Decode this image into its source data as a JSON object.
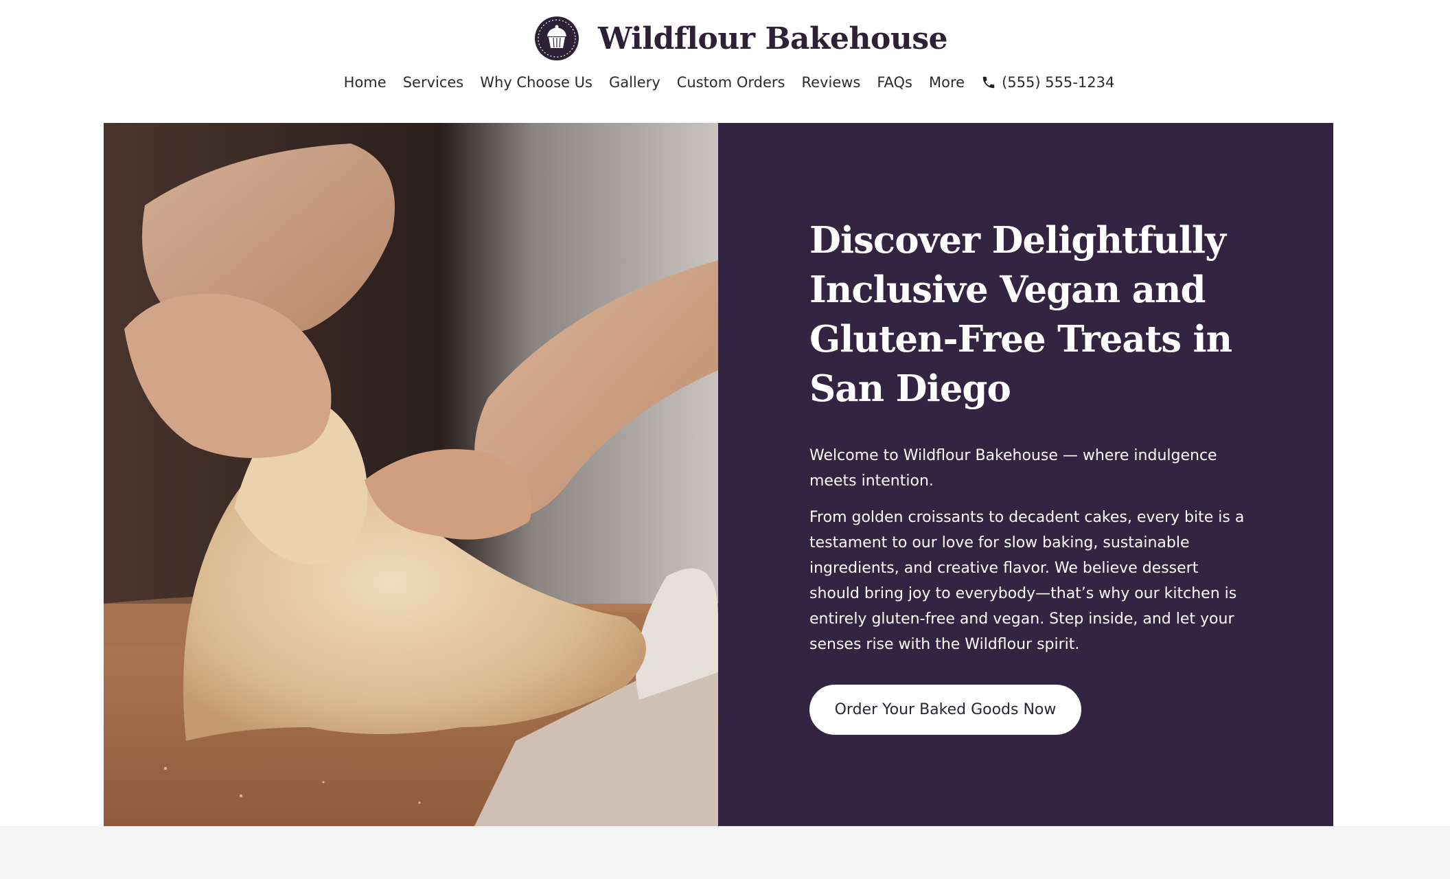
{
  "site": {
    "name": "Wildflour Bakehouse",
    "logo_icon": "cupcake-badge-icon"
  },
  "nav": {
    "items": [
      {
        "label": "Home"
      },
      {
        "label": "Services"
      },
      {
        "label": "Why Choose Us"
      },
      {
        "label": "Gallery"
      },
      {
        "label": "Custom Orders"
      },
      {
        "label": "Reviews"
      },
      {
        "label": "FAQs"
      },
      {
        "label": "More"
      }
    ],
    "phone": {
      "icon": "phone-icon",
      "label": "(555) 555-1234"
    }
  },
  "hero": {
    "image": "dough-kneading-photo",
    "title": "Discover Delightfully Inclusive Vegan and Gluten-Free Treats in San Diego",
    "intro": "Welcome to Wildflour Bakehouse — where indulgence meets intention.",
    "body": "From golden croissants to decadent cakes, every bite is a testament to our love for slow baking, sustainable ingredients, and creative flavor. We believe dessert should bring joy to everybody—that’s why our kitchen is entirely gluten-free and vegan. Step inside, and let your senses rise with the Wildflour spirit.",
    "cta_label": "Order Your Baked Goods Now"
  },
  "colors": {
    "brand_dark": "#2d2136",
    "hero_panel": "#332541",
    "text_light": "#ffffff",
    "page_bg": "#ffffff",
    "footer_strip": "#f5f5f5"
  }
}
